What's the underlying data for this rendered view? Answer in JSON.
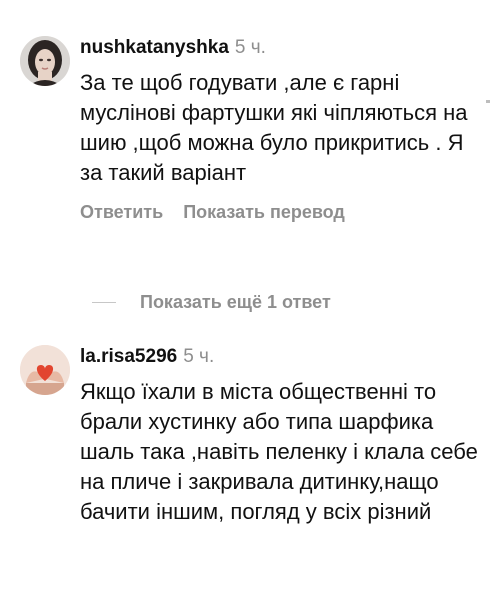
{
  "comments": [
    {
      "username": "nushkatanyshka",
      "time": "5 ч.",
      "text": "За те щоб годувати ,але є гарні муслінові фартушки які чіпляються на шию ,щоб можна було прикритись . Я за такий варіант",
      "actions": {
        "reply": "Ответить",
        "translate": "Показать перевод"
      }
    },
    {
      "username": "la.risa5296",
      "time": "5 ч.",
      "text": "Якщо їхали в міста общественні то брали хустинку або типа шарфика шаль така ,навіть пеленку і клала себе на пличе і закривала дитинку,нащо бачити іншим, погляд у всіх різний"
    }
  ],
  "more_replies": "Показать ещё 1 ответ",
  "colors": {
    "text": "#111111",
    "muted": "#8e8e8e"
  },
  "icons": {
    "avatar_1": "woman-portrait",
    "avatar_2": "heart-in-hands"
  }
}
